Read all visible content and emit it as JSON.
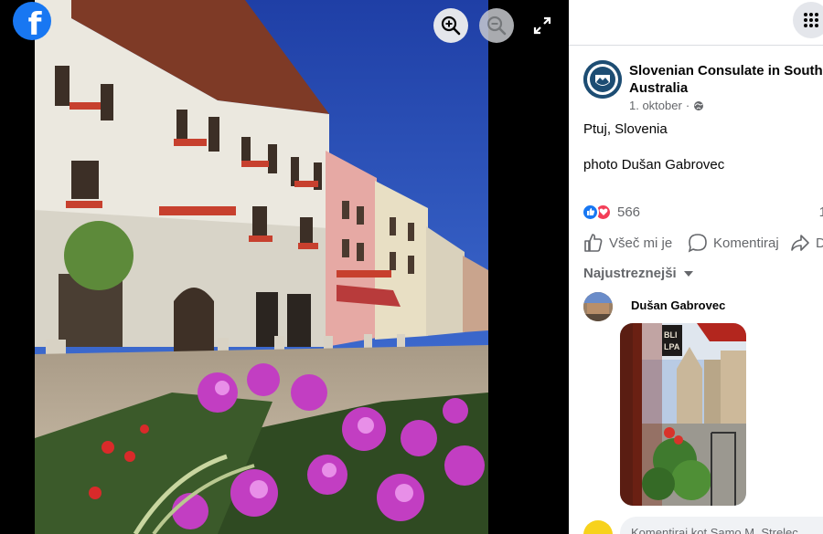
{
  "viewer": {
    "logo_letter": "f",
    "icons": [
      "facebook-logo",
      "zoom-in-icon",
      "zoom-out-icon",
      "fullscreen-icon"
    ]
  },
  "post": {
    "page_name": "Slovenian Consulate in South Australia",
    "date": "1. oktober",
    "meta_separator": "·",
    "audience_icon": "globe-icon",
    "caption_line1": "Ptuj, Slovenia",
    "caption_line2": "photo Dušan Gabrovec",
    "reaction_count": "566",
    "reaction_right": "1",
    "like_label": "Všeč mi je",
    "comment_label": "Komentiraj",
    "share_label": "D",
    "sort_label": "Najustreznejši"
  },
  "comment": {
    "author": "Dušan Gabrovec",
    "photo_sign_text": "BLI LPA"
  },
  "composer": {
    "placeholder": "Komentiraj kot Samo M. Strelec"
  },
  "colors": {
    "brand": "#1877f2",
    "love": "#f33e58",
    "secondary_text": "#65676b",
    "panel_bg": "#ffffff"
  }
}
